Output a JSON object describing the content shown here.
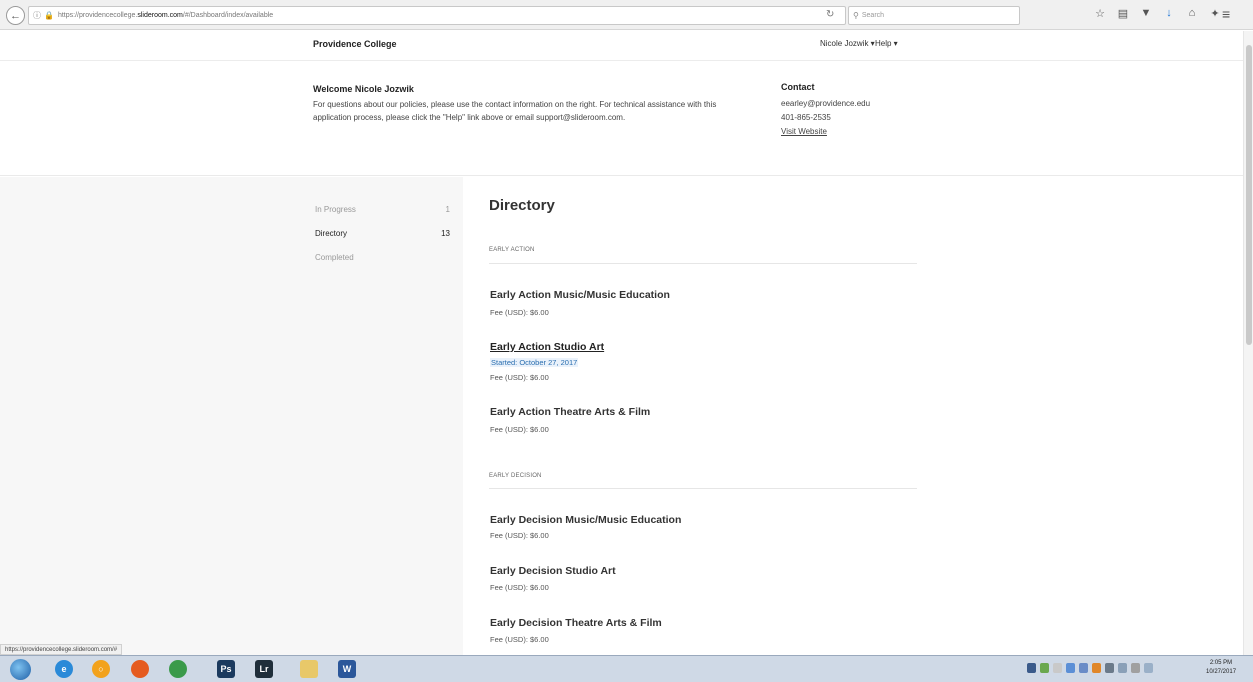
{
  "browser": {
    "url_prefix": "https://providencecollege.",
    "url_domain": "slideroom.com",
    "url_suffix": "/#/Dashboard/index/available",
    "search_placeholder": "Search"
  },
  "header": {
    "brand": "Providence College",
    "user_menu": "Nicole Jozwik ▾",
    "help_menu": "Help ▾"
  },
  "welcome": {
    "title": "Welcome Nicole Jozwik",
    "text": "For questions about our policies, please use the contact information on the right. For technical assistance with this application process, please click the \"Help\" link above or email support@slideroom.com."
  },
  "contact": {
    "title": "Contact",
    "email": "eearley@providence.edu",
    "phone": "401-865-2535",
    "link": "Visit Website"
  },
  "sidebar": {
    "items": [
      {
        "label": "In Progress",
        "count": "1"
      },
      {
        "label": "Directory",
        "count": "13"
      },
      {
        "label": "Completed",
        "count": ""
      }
    ]
  },
  "main": {
    "title": "Directory",
    "sections": [
      {
        "label": "EARLY ACTION",
        "programs": [
          {
            "title": "Early Action Music/Music Education",
            "started": "",
            "fee": "Fee (USD): $6.00"
          },
          {
            "title": "Early Action Studio Art",
            "started": "Started: October 27, 2017",
            "fee": "Fee (USD): $6.00"
          },
          {
            "title": "Early Action Theatre Arts & Film",
            "started": "",
            "fee": "Fee (USD): $6.00"
          }
        ]
      },
      {
        "label": "EARLY DECISION",
        "programs": [
          {
            "title": "Early Decision Music/Music Education",
            "started": "",
            "fee": "Fee (USD): $6.00"
          },
          {
            "title": "Early Decision Studio Art",
            "started": "",
            "fee": "Fee (USD): $6.00"
          },
          {
            "title": "Early Decision Theatre Arts & Film",
            "started": "",
            "fee": "Fee (USD): $6.00"
          }
        ]
      }
    ]
  },
  "status_bar_url": "https://providencecollege.slideroom.com/#",
  "taskbar": {
    "time": "2:05 PM",
    "date": "10/27/2017"
  }
}
